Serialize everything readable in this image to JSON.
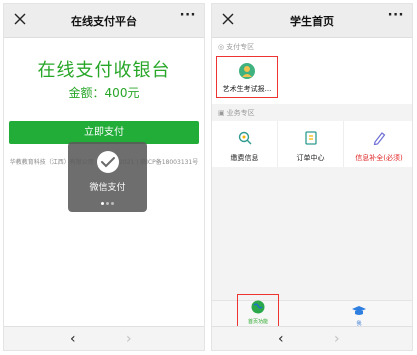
{
  "left": {
    "nav_title": "在线支付平台",
    "more": "···",
    "cashier_title": "在线支付收银台",
    "amount": "金额：400元",
    "pay_button": "立即支付",
    "footer": "华教教育科技（江西）有限公司 ©2015-2021 | 赣ICP备18003131号",
    "toast_text": "微信支付",
    "back": "‹",
    "forward": "›"
  },
  "right": {
    "nav_title": "学生首页",
    "more": "···",
    "section_payment": "支付专区",
    "exam_item": "艺术生考试报...",
    "section_business": "业务专区",
    "biz_items": [
      "缴费信息",
      "订单中心",
      "信息补全(必须)"
    ],
    "tab_home": "首页功能",
    "tab_me": "我",
    "back": "‹",
    "forward": "›"
  },
  "colors": {
    "accent_green": "#22ac38",
    "warning_red": "#e02424",
    "highlight_box": "#ee3333"
  },
  "icons": [
    "close-icon",
    "more-icon",
    "wechat-pay-icon",
    "search-icon",
    "document-icon",
    "pencil-icon",
    "graduation-cap-icon",
    "globe-icon",
    "avatar-icon"
  ]
}
